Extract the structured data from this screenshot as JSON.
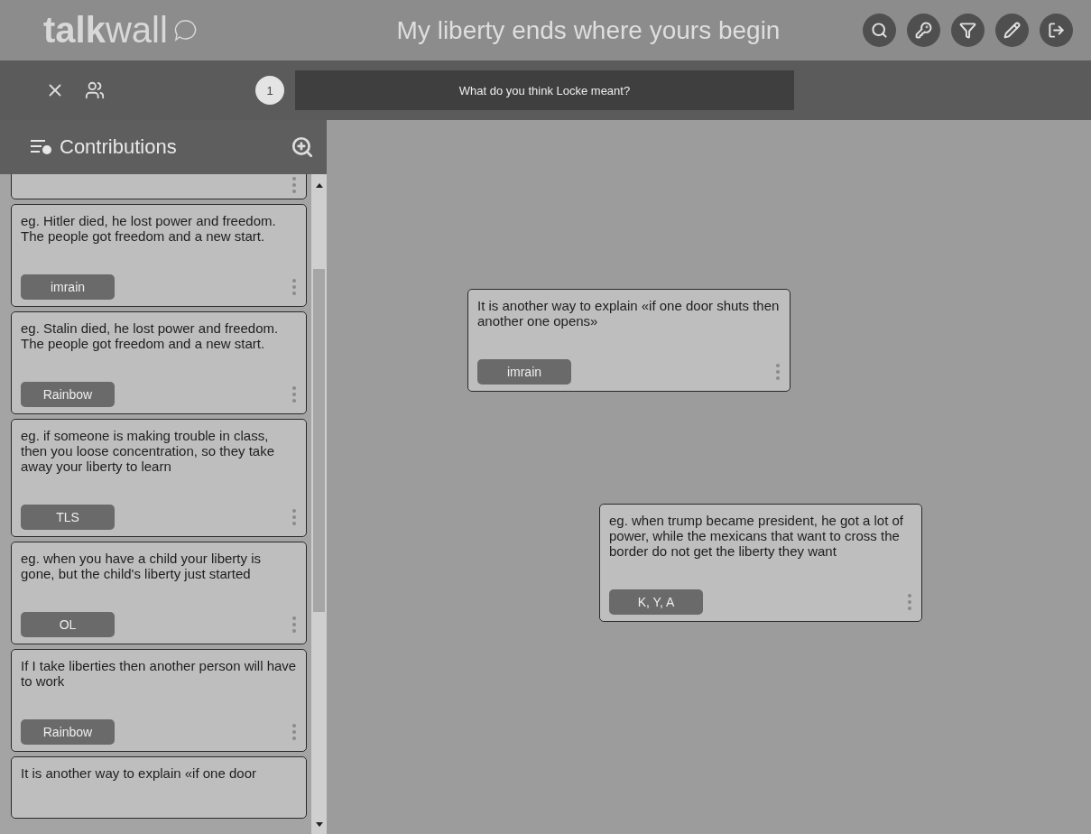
{
  "header": {
    "logo_bold": "talk",
    "logo_light": "wall",
    "title": "My liberty ends where yours begin",
    "actions": [
      {
        "kind": "zoom"
      },
      {
        "kind": "key"
      },
      {
        "kind": "filter"
      },
      {
        "kind": "edit"
      },
      {
        "kind": "logout"
      }
    ]
  },
  "question_bar": {
    "count": "1",
    "question": "What do you think Locke meant?"
  },
  "sidebar": {
    "title": "Contributions",
    "cards": [
      {
        "text": "eg. Hitler died, he lost power and freedom. The people got freedom and a new start.",
        "author": "imrain"
      },
      {
        "text": "eg. Stalin died, he lost power and freedom. The people got freedom and a new start.",
        "author": "Rainbow"
      },
      {
        "text": "eg. if someone is making trouble in class, then you loose concentration, so they take away your liberty to learn",
        "author": "TLS"
      },
      {
        "text": "eg. when you have a child your liberty is gone, but the child's liberty just started",
        "author": "OL"
      },
      {
        "text": "If I take liberties then another person will have to work",
        "author": "Rainbow"
      },
      {
        "text": "It is another way to explain «if one door"
      }
    ]
  },
  "wall": {
    "notes": [
      {
        "text": "It is another way to explain «if one door shuts then another one opens»",
        "author": "imrain"
      },
      {
        "text": "eg. when trump became president, he got a lot of power, while the mexicans that want to cross the border do not get the liberty they want",
        "author": "K, Y, A"
      }
    ]
  }
}
